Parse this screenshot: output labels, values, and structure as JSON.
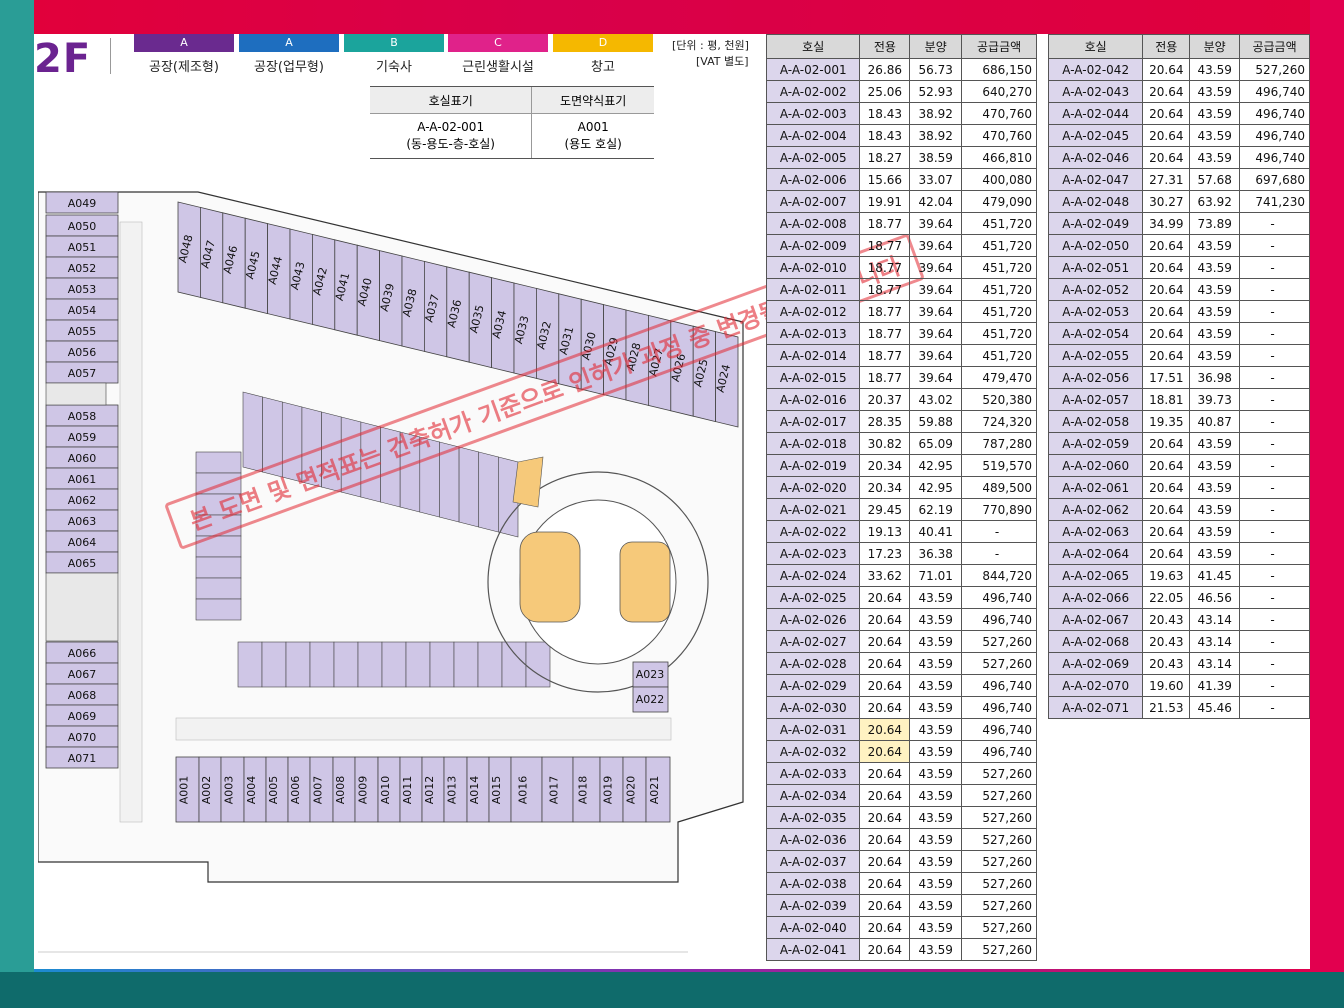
{
  "floor": "2F",
  "legend": [
    {
      "code": "A",
      "label": "공장(제조형)",
      "color": "#6a2a8f"
    },
    {
      "code": "A",
      "label": "공장(업무형)",
      "color": "#1e6ebf"
    },
    {
      "code": "B",
      "label": "기숙사",
      "color": "#1ba49c"
    },
    {
      "code": "C",
      "label": "근린생활시설",
      "color": "#e0228a"
    },
    {
      "code": "D",
      "label": "창고",
      "color": "#f5b800"
    }
  ],
  "unit_note": {
    "line1": "[단위 : 평, 천원]",
    "line2": "[VAT 별도]"
  },
  "code_table": {
    "headers": [
      "호실표기",
      "도면약식표기"
    ],
    "row1": [
      "A-A-02-001",
      "A001"
    ],
    "row2": [
      "(동-용도-층-호실)",
      "(용도 호실)"
    ]
  },
  "stamp_text": "본 도면 및 면적표는 건축허가 기준으로 인허가 과정 중 변경될 수 있습니다",
  "table_headers": [
    "호실",
    "전용",
    "분양",
    "공급금액"
  ],
  "table_left": [
    [
      "A-A-02-001",
      "26.86",
      "56.73",
      "686,150"
    ],
    [
      "A-A-02-002",
      "25.06",
      "52.93",
      "640,270"
    ],
    [
      "A-A-02-003",
      "18.43",
      "38.92",
      "470,760"
    ],
    [
      "A-A-02-004",
      "18.43",
      "38.92",
      "470,760"
    ],
    [
      "A-A-02-005",
      "18.27",
      "38.59",
      "466,810"
    ],
    [
      "A-A-02-006",
      "15.66",
      "33.07",
      "400,080"
    ],
    [
      "A-A-02-007",
      "19.91",
      "42.04",
      "479,090"
    ],
    [
      "A-A-02-008",
      "18.77",
      "39.64",
      "451,720"
    ],
    [
      "A-A-02-009",
      "18.77",
      "39.64",
      "451,720"
    ],
    [
      "A-A-02-010",
      "18.77",
      "39.64",
      "451,720"
    ],
    [
      "A-A-02-011",
      "18.77",
      "39.64",
      "451,720"
    ],
    [
      "A-A-02-012",
      "18.77",
      "39.64",
      "451,720"
    ],
    [
      "A-A-02-013",
      "18.77",
      "39.64",
      "451,720"
    ],
    [
      "A-A-02-014",
      "18.77",
      "39.64",
      "451,720"
    ],
    [
      "A-A-02-015",
      "18.77",
      "39.64",
      "479,470"
    ],
    [
      "A-A-02-016",
      "20.37",
      "43.02",
      "520,380"
    ],
    [
      "A-A-02-017",
      "28.35",
      "59.88",
      "724,320"
    ],
    [
      "A-A-02-018",
      "30.82",
      "65.09",
      "787,280"
    ],
    [
      "A-A-02-019",
      "20.34",
      "42.95",
      "519,570"
    ],
    [
      "A-A-02-020",
      "20.34",
      "42.95",
      "489,500"
    ],
    [
      "A-A-02-021",
      "29.45",
      "62.19",
      "770,890"
    ],
    [
      "A-A-02-022",
      "19.13",
      "40.41",
      "-"
    ],
    [
      "A-A-02-023",
      "17.23",
      "36.38",
      "-"
    ],
    [
      "A-A-02-024",
      "33.62",
      "71.01",
      "844,720"
    ],
    [
      "A-A-02-025",
      "20.64",
      "43.59",
      "496,740"
    ],
    [
      "A-A-02-026",
      "20.64",
      "43.59",
      "496,740"
    ],
    [
      "A-A-02-027",
      "20.64",
      "43.59",
      "527,260"
    ],
    [
      "A-A-02-028",
      "20.64",
      "43.59",
      "527,260"
    ],
    [
      "A-A-02-029",
      "20.64",
      "43.59",
      "496,740"
    ],
    [
      "A-A-02-030",
      "20.64",
      "43.59",
      "496,740"
    ],
    [
      "A-A-02-031",
      "20.64",
      "43.59",
      "496,740"
    ],
    [
      "A-A-02-032",
      "20.64",
      "43.59",
      "496,740"
    ],
    [
      "A-A-02-033",
      "20.64",
      "43.59",
      "527,260"
    ],
    [
      "A-A-02-034",
      "20.64",
      "43.59",
      "527,260"
    ],
    [
      "A-A-02-035",
      "20.64",
      "43.59",
      "527,260"
    ],
    [
      "A-A-02-036",
      "20.64",
      "43.59",
      "527,260"
    ],
    [
      "A-A-02-037",
      "20.64",
      "43.59",
      "527,260"
    ],
    [
      "A-A-02-038",
      "20.64",
      "43.59",
      "527,260"
    ],
    [
      "A-A-02-039",
      "20.64",
      "43.59",
      "527,260"
    ],
    [
      "A-A-02-040",
      "20.64",
      "43.59",
      "527,260"
    ],
    [
      "A-A-02-041",
      "20.64",
      "43.59",
      "527,260"
    ]
  ],
  "table_right": [
    [
      "A-A-02-042",
      "20.64",
      "43.59",
      "527,260"
    ],
    [
      "A-A-02-043",
      "20.64",
      "43.59",
      "496,740"
    ],
    [
      "A-A-02-044",
      "20.64",
      "43.59",
      "496,740"
    ],
    [
      "A-A-02-045",
      "20.64",
      "43.59",
      "496,740"
    ],
    [
      "A-A-02-046",
      "20.64",
      "43.59",
      "496,740"
    ],
    [
      "A-A-02-047",
      "27.31",
      "57.68",
      "697,680"
    ],
    [
      "A-A-02-048",
      "30.27",
      "63.92",
      "741,230"
    ],
    [
      "A-A-02-049",
      "34.99",
      "73.89",
      "-"
    ],
    [
      "A-A-02-050",
      "20.64",
      "43.59",
      "-"
    ],
    [
      "A-A-02-051",
      "20.64",
      "43.59",
      "-"
    ],
    [
      "A-A-02-052",
      "20.64",
      "43.59",
      "-"
    ],
    [
      "A-A-02-053",
      "20.64",
      "43.59",
      "-"
    ],
    [
      "A-A-02-054",
      "20.64",
      "43.59",
      "-"
    ],
    [
      "A-A-02-055",
      "20.64",
      "43.59",
      "-"
    ],
    [
      "A-A-02-056",
      "17.51",
      "36.98",
      "-"
    ],
    [
      "A-A-02-057",
      "18.81",
      "39.73",
      "-"
    ],
    [
      "A-A-02-058",
      "19.35",
      "40.87",
      "-"
    ],
    [
      "A-A-02-059",
      "20.64",
      "43.59",
      "-"
    ],
    [
      "A-A-02-060",
      "20.64",
      "43.59",
      "-"
    ],
    [
      "A-A-02-061",
      "20.64",
      "43.59",
      "-"
    ],
    [
      "A-A-02-062",
      "20.64",
      "43.59",
      "-"
    ],
    [
      "A-A-02-063",
      "20.64",
      "43.59",
      "-"
    ],
    [
      "A-A-02-064",
      "20.64",
      "43.59",
      "-"
    ],
    [
      "A-A-02-065",
      "19.63",
      "41.45",
      "-"
    ],
    [
      "A-A-02-066",
      "22.05",
      "46.56",
      "-"
    ],
    [
      "A-A-02-067",
      "20.43",
      "43.14",
      "-"
    ],
    [
      "A-A-02-068",
      "20.43",
      "43.14",
      "-"
    ],
    [
      "A-A-02-069",
      "20.43",
      "43.14",
      "-"
    ],
    [
      "A-A-02-070",
      "19.60",
      "41.39",
      "-"
    ],
    [
      "A-A-02-071",
      "21.53",
      "45.46",
      "-"
    ]
  ],
  "plan_units": {
    "west_column": [
      "A049",
      "A050",
      "A051",
      "A052",
      "A053",
      "A054",
      "A055",
      "A056",
      "A057",
      "A058",
      "A059",
      "A060",
      "A061",
      "A062",
      "A063",
      "A064",
      "A065",
      "A066",
      "A067",
      "A068",
      "A069",
      "A070",
      "A071"
    ],
    "north_diagonal": [
      "A048",
      "A047",
      "A046",
      "A045",
      "A044",
      "A043",
      "A042",
      "A041",
      "A040",
      "A039",
      "A038",
      "A037",
      "A036",
      "A035",
      "A034",
      "A033",
      "A032",
      "A031",
      "A030",
      "A029",
      "A028",
      "A027",
      "A026",
      "A025",
      "A024"
    ],
    "south_row": [
      "A001",
      "A002",
      "A003",
      "A004",
      "A005",
      "A006",
      "A007",
      "A008",
      "A009",
      "A010",
      "A011",
      "A012",
      "A013",
      "A014",
      "A015",
      "A016",
      "A017",
      "A018",
      "A019",
      "A020",
      "A021"
    ],
    "east_small": [
      "A023",
      "A022"
    ]
  }
}
